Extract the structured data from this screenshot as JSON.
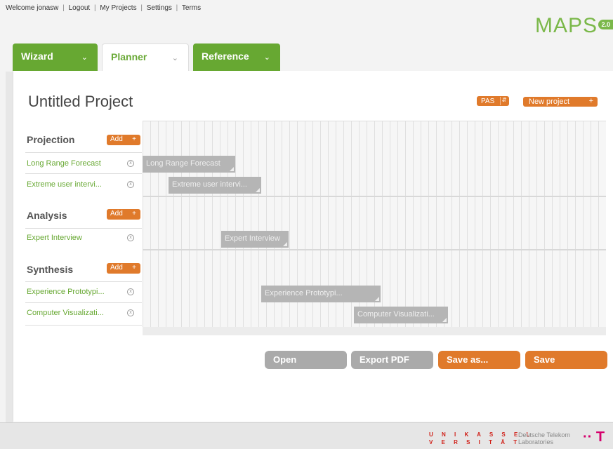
{
  "topnav": {
    "welcome": "Welcome jonasw",
    "logout": "Logout",
    "projects": "My Projects",
    "settings": "Settings",
    "terms": "Terms"
  },
  "brand": {
    "name": "MAPS",
    "version": "2.0",
    "accent": "#7bb84a"
  },
  "tabs": [
    {
      "label": "Wizard",
      "chevron": "chevron-down-icon"
    },
    {
      "label": "Planner",
      "chevron": "chevron-down-icon"
    },
    {
      "label": "Reference",
      "chevron": "chevron-down-icon"
    }
  ],
  "project": {
    "title": "Untitled Project",
    "pas_label": "PAS",
    "new_project_label": "New project",
    "new_project_plus": "+"
  },
  "sections": [
    {
      "name": "Projection",
      "add_label": "Add",
      "items": [
        {
          "label": "Long Range Forecast",
          "bar_label": "Long Range Forecast"
        },
        {
          "label": "Extreme user intervi...",
          "bar_label": "Extreme user intervi..."
        }
      ]
    },
    {
      "name": "Analysis",
      "add_label": "Add",
      "items": [
        {
          "label": "Expert Interview",
          "bar_label": "Expert Interview"
        }
      ]
    },
    {
      "name": "Synthesis",
      "add_label": "Add",
      "items": [
        {
          "label": "Experience Prototypi...",
          "bar_label": "Experience Prototypi..."
        },
        {
          "label": "Computer Visualizati...",
          "bar_label": "Computer Visualizati..."
        }
      ]
    }
  ],
  "buttons": {
    "open": "Open",
    "export": "Export PDF",
    "save_as": "Save as...",
    "save": "Save"
  },
  "footer": {
    "uni_line1": "U N I K A S S E L",
    "uni_line2": "V E R S I T Ä T",
    "dt_line1": "Deutsche Telekom",
    "dt_line2": "Laboratories",
    "t_logo": "·· T ·"
  },
  "colors": {
    "green": "#67a832",
    "orange": "#e07a2b",
    "bar": "#b5b5b5"
  }
}
